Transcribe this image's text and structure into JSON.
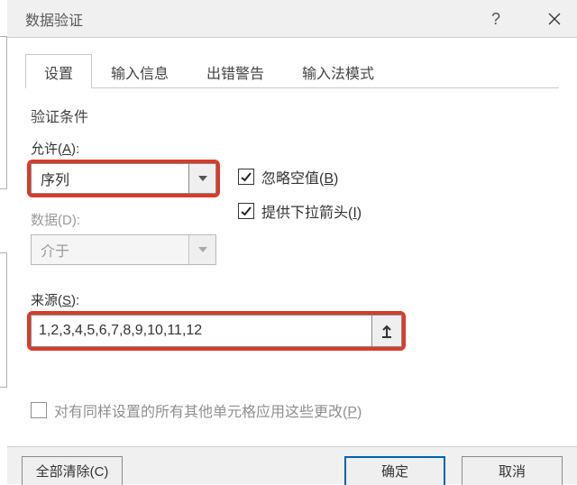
{
  "window": {
    "title": "数据验证"
  },
  "tabs": [
    {
      "label": "设置"
    },
    {
      "label": "输入信息"
    },
    {
      "label": "出错警告"
    },
    {
      "label": "输入法模式"
    }
  ],
  "criteria_heading": "验证条件",
  "allow": {
    "label_prefix": "允许(",
    "label_key": "A",
    "label_suffix": "):",
    "value": "序列"
  },
  "data": {
    "label": "数据(D):",
    "value": "介于"
  },
  "ignore_blank": {
    "label_prefix": "忽略空值(",
    "label_key": "B",
    "label_suffix": ")",
    "checked": true
  },
  "incell_dropdown": {
    "label_prefix": "提供下拉箭头(",
    "label_key": "I",
    "label_suffix": ")",
    "checked": true
  },
  "source": {
    "label_prefix": "来源(",
    "label_key": "S",
    "label_suffix": "):",
    "value": "1,2,3,4,5,6,7,8,9,10,11,12"
  },
  "apply_all": {
    "label_prefix": "对有同样设置的所有其他单元格应用这些更改(",
    "label_key": "P",
    "label_suffix": ")",
    "checked": false
  },
  "footer": {
    "clear_all": "全部清除(C)",
    "ok": "确定",
    "cancel": "取消"
  }
}
